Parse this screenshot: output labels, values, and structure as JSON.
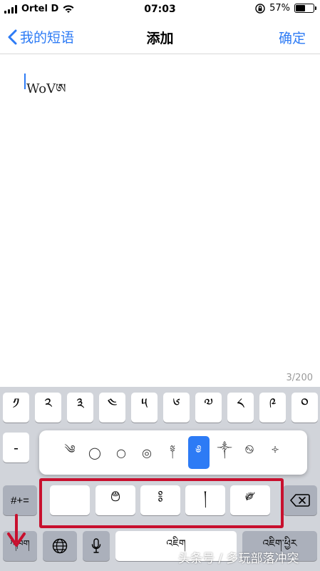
{
  "status_bar": {
    "carrier": "Ortel D",
    "time": "07:03",
    "battery": "57%",
    "battery_level": 0.57
  },
  "nav": {
    "back_label": "我的短语",
    "title": "添加",
    "done_label": "确定"
  },
  "editor": {
    "text": "WoVཨ",
    "char_count": "3/200"
  },
  "keyboard": {
    "row1": [
      "༡",
      "༢",
      "༣",
      "༤",
      "༥",
      "༦",
      "༧",
      "༨",
      "༩",
      "༠"
    ],
    "row2_left": "-",
    "popup": [
      "༄",
      "◯",
      "○",
      "◎",
      "༈",
      "༅",
      "༒",
      "࿊",
      "༓"
    ],
    "popup_selected_index": 5,
    "row3": [
      "",
      "࿉",
      "༔",
      "།",
      "༗"
    ],
    "symbols_label": "#+=",
    "delete_icon": "backspace-icon",
    "lang_label": "ཀཁག",
    "space_label": "འཇིག",
    "return_label": "འཇིག་ཕྱིར"
  },
  "watermark": "头条号 / 多玩部落冲突",
  "colors": {
    "accent": "#2d7bf5",
    "highlight": "#c8102e",
    "keyboard_bg": "#d1d4da"
  }
}
